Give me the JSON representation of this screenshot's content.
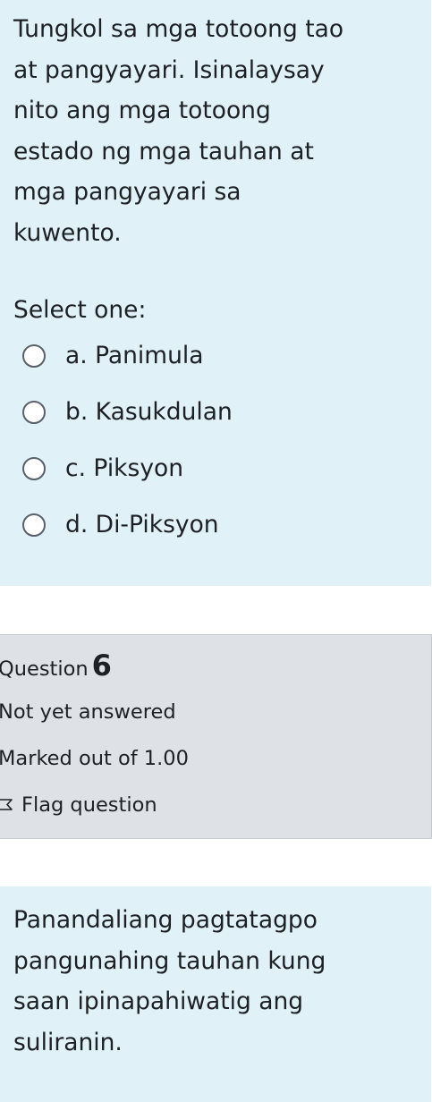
{
  "question5": {
    "text_lines": [
      "Tungkol sa mga totoong tao",
      "at pangyayari. Isinalaysay",
      "nito ang mga totoong",
      "estado ng mga tauhan at",
      "mga pangyayari sa",
      "kuwento."
    ],
    "prompt": "Select one:",
    "options": [
      {
        "label": "a. Panimula",
        "selected": false
      },
      {
        "label": "b. Kasukdulan",
        "selected": false
      },
      {
        "label": "c. Piksyon",
        "selected": false
      },
      {
        "label": "d. Di-Piksyon",
        "selected": false
      }
    ]
  },
  "question6_info": {
    "label": "Question",
    "number": "6",
    "state": "Not yet answered",
    "grade": "Marked out of 1.00",
    "flag_label": "Flag question",
    "flag_icon": "flag-outline-icon"
  },
  "question6": {
    "text_lines": [
      "Panandaliang pagtatagpo",
      "pangunahing tauhan kung",
      "saan ipinapahiwatig ang",
      "suliranin."
    ]
  }
}
